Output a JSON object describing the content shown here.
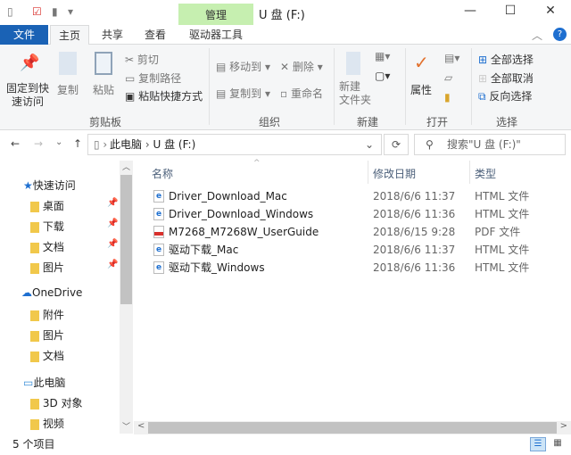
{
  "window": {
    "title": "U 盘 (F:)",
    "context_tab": "管理",
    "minimize": "—",
    "maximize": "☐",
    "close": "✕"
  },
  "tabs": [
    {
      "label": "文件"
    },
    {
      "label": "主页"
    },
    {
      "label": "共享"
    },
    {
      "label": "查看"
    },
    {
      "label": "驱动器工具"
    }
  ],
  "ribbon": {
    "clipboard": {
      "label": "剪贴板",
      "pin": "固定到快速访问",
      "copy": "复制",
      "paste": "粘贴",
      "cut": "剪切",
      "copy_path": "复制路径",
      "paste_shortcut": "粘贴快捷方式"
    },
    "organize": {
      "label": "组织",
      "move_to": "移动到",
      "copy_to": "复制到",
      "delete": "删除",
      "rename": "重命名"
    },
    "new": {
      "label": "新建",
      "new_folder": "新建\n文件夹"
    },
    "open": {
      "label": "打开",
      "properties": "属性"
    },
    "select": {
      "label": "选择",
      "select_all": "全部选择",
      "select_none": "全部取消",
      "invert": "反向选择"
    }
  },
  "address": {
    "path": [
      "此电脑",
      "U 盘 (F:)"
    ],
    "search_placeholder": "搜索\"U 盘 (F:)\""
  },
  "nav": {
    "quick_access": "快速访问",
    "quick_items": [
      "桌面",
      "下载",
      "文档",
      "图片"
    ],
    "onedrive": "OneDrive",
    "onedrive_items": [
      "附件",
      "图片",
      "文档"
    ],
    "this_pc": "此电脑",
    "pc_items": [
      "3D 对象",
      "视频"
    ]
  },
  "columns": {
    "name": "名称",
    "date": "修改日期",
    "type": "类型"
  },
  "files": [
    {
      "name": "Driver_Download_Mac",
      "date": "2018/6/6 11:37",
      "type": "HTML 文件",
      "icon": "html"
    },
    {
      "name": "Driver_Download_Windows",
      "date": "2018/6/6 11:36",
      "type": "HTML 文件",
      "icon": "html"
    },
    {
      "name": "M7268_M7268W_UserGuide",
      "date": "2018/6/15 9:28",
      "type": "PDF 文件",
      "icon": "pdf"
    },
    {
      "name": "驱动下载_Mac",
      "date": "2018/6/6 11:37",
      "type": "HTML 文件",
      "icon": "html"
    },
    {
      "name": "驱动下载_Windows",
      "date": "2018/6/6 11:36",
      "type": "HTML 文件",
      "icon": "html"
    }
  ],
  "status": {
    "count": "5 个项目"
  }
}
